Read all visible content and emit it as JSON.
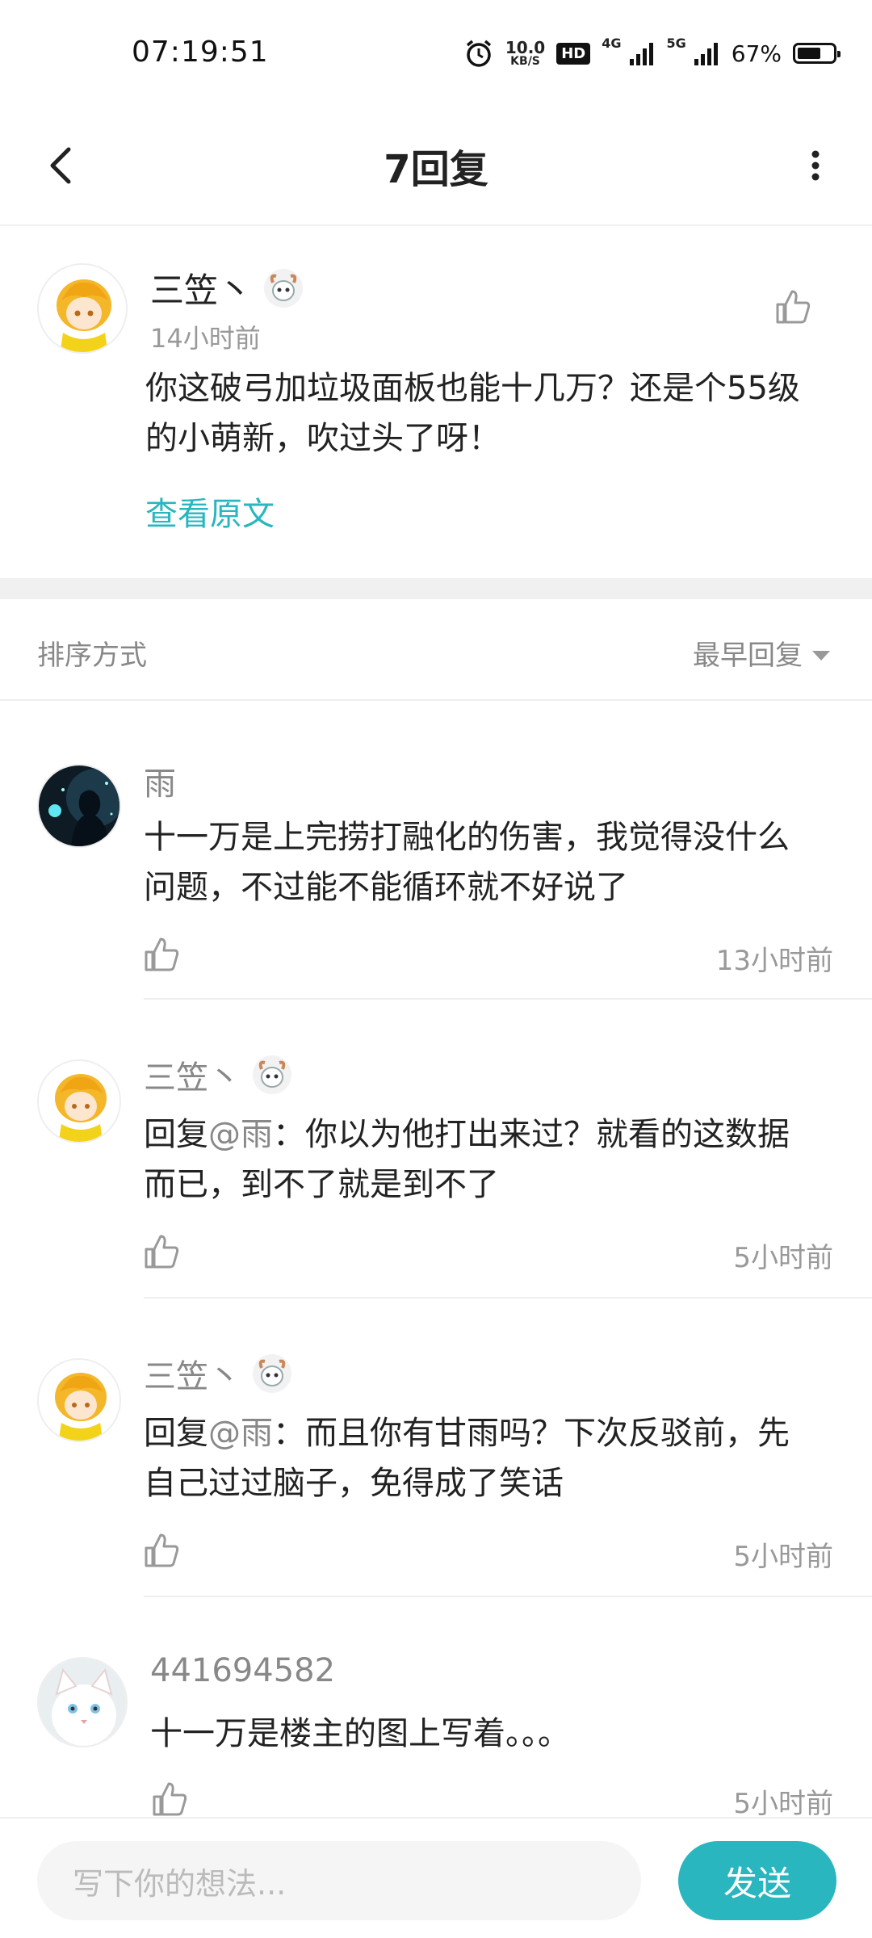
{
  "status_bar": {
    "time": "07:19:51",
    "net_speed_value": "10.0",
    "net_speed_unit": "KB/S",
    "hd_label": "HD",
    "net1_label": "4G",
    "net2_label": "5G",
    "battery_percent": "67%",
    "battery_level": 0.67,
    "icons": [
      "alarm-icon",
      "hd-icon",
      "signal-4g-icon",
      "signal-5g-icon",
      "battery-icon"
    ]
  },
  "nav": {
    "title": "7回复",
    "back_icon": "back-arrow-icon",
    "more_icon": "more-vertical-icon"
  },
  "original_comment": {
    "username": "三笠丶",
    "time": "14小时前",
    "content_line1": "你这破弓加垃圾面板也能十几万？还是个55级",
    "content_line2": "的小萌新，吹过头了呀！",
    "view_original": "查看原文"
  },
  "sort": {
    "label": "排序方式",
    "selected": "最早回复"
  },
  "replies": [
    {
      "username": "雨",
      "content_line1": "十一万是上完捞打融化的伤害，我觉得没什么",
      "content_line2": "问题，不过能不能循环就不好说了",
      "time": "13小时前"
    },
    {
      "username": "三笠丶",
      "reply_prefix": "回复",
      "mention": "@雨",
      "content_line1_rest": "：你以为他打出来过？就看的这数据",
      "content_line2": "而已，到不了就是到不了",
      "time": "5小时前"
    },
    {
      "username": "三笠丶",
      "reply_prefix": "回复",
      "mention": "@雨",
      "content_line1_rest": "：而且你有甘雨吗？下次反驳前，先",
      "content_line2": "自己过过脑子，免得成了笑话",
      "time": "5小时前"
    },
    {
      "username": "441694582",
      "content_line1": "十一万是楼主的图上写着。。。",
      "time": "5小时前"
    }
  ],
  "bottom": {
    "input_placeholder": "写下你的想法...",
    "send_label": "发送"
  },
  "colors": {
    "accent": "#29b6bf",
    "separator": "#f0f0f0"
  }
}
